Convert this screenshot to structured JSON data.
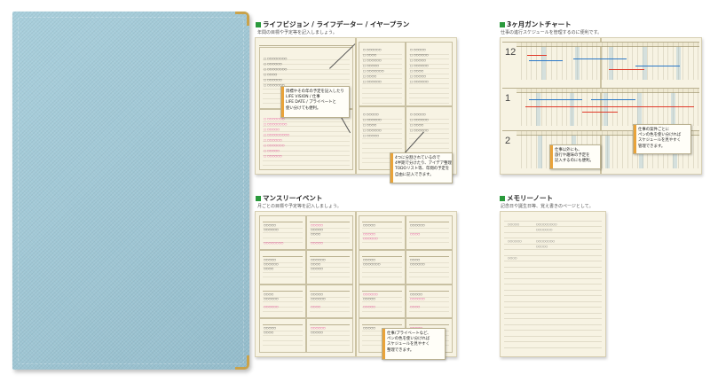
{
  "sections": {
    "life": {
      "title": "ライフビジョン / ライフデーター / イヤープラン",
      "sub": "年間の目標や予定等を記入しましょう。",
      "callout1": [
        "目標やその年の予定を記入したり",
        "LIFE VISION / 仕事",
        "LIFE DATE / プライベートと",
        "使い分けても便利。"
      ],
      "callout2": [
        "4つに分割されているので",
        "4半期で分けたり、アイデア整理",
        "TODOリスト等、年間の予定を",
        "自由に記入できます。"
      ]
    },
    "gantt": {
      "title": "3ヶ月ガントチャート",
      "sub": "仕事の進行スケジュールを管理するのに便利です。",
      "months": [
        "12",
        "1",
        "2"
      ],
      "callout1": [
        "仕事以外にも、",
        "旅行や趣味の予定を",
        "記入するのにも便利。"
      ],
      "callout2": [
        "仕事の案件ごとに",
        "ペンの色を使い分ければ",
        "スケジュールを見やすく",
        "管理できます。"
      ]
    },
    "monthly": {
      "title": "マンスリーイベント",
      "sub": "月ごとの目標や予定等を記入しましょう。",
      "callout": [
        "仕事/プライベートなど、",
        "ペンの色を使い分ければ",
        "スケジュールを見やすく",
        "整理できます。"
      ]
    },
    "memo": {
      "title": "メモリーノート",
      "sub": "記念日や誕生日等、覚え書きのページとして。"
    }
  },
  "colors": {
    "accent_green": "#2a9a3c",
    "cover_blue": "#a3cad8",
    "corner_gold": "#c9a24a",
    "ink_pink": "#e0308a",
    "ink_blue": "#2a78c8",
    "ink_red": "#e03a2a"
  }
}
